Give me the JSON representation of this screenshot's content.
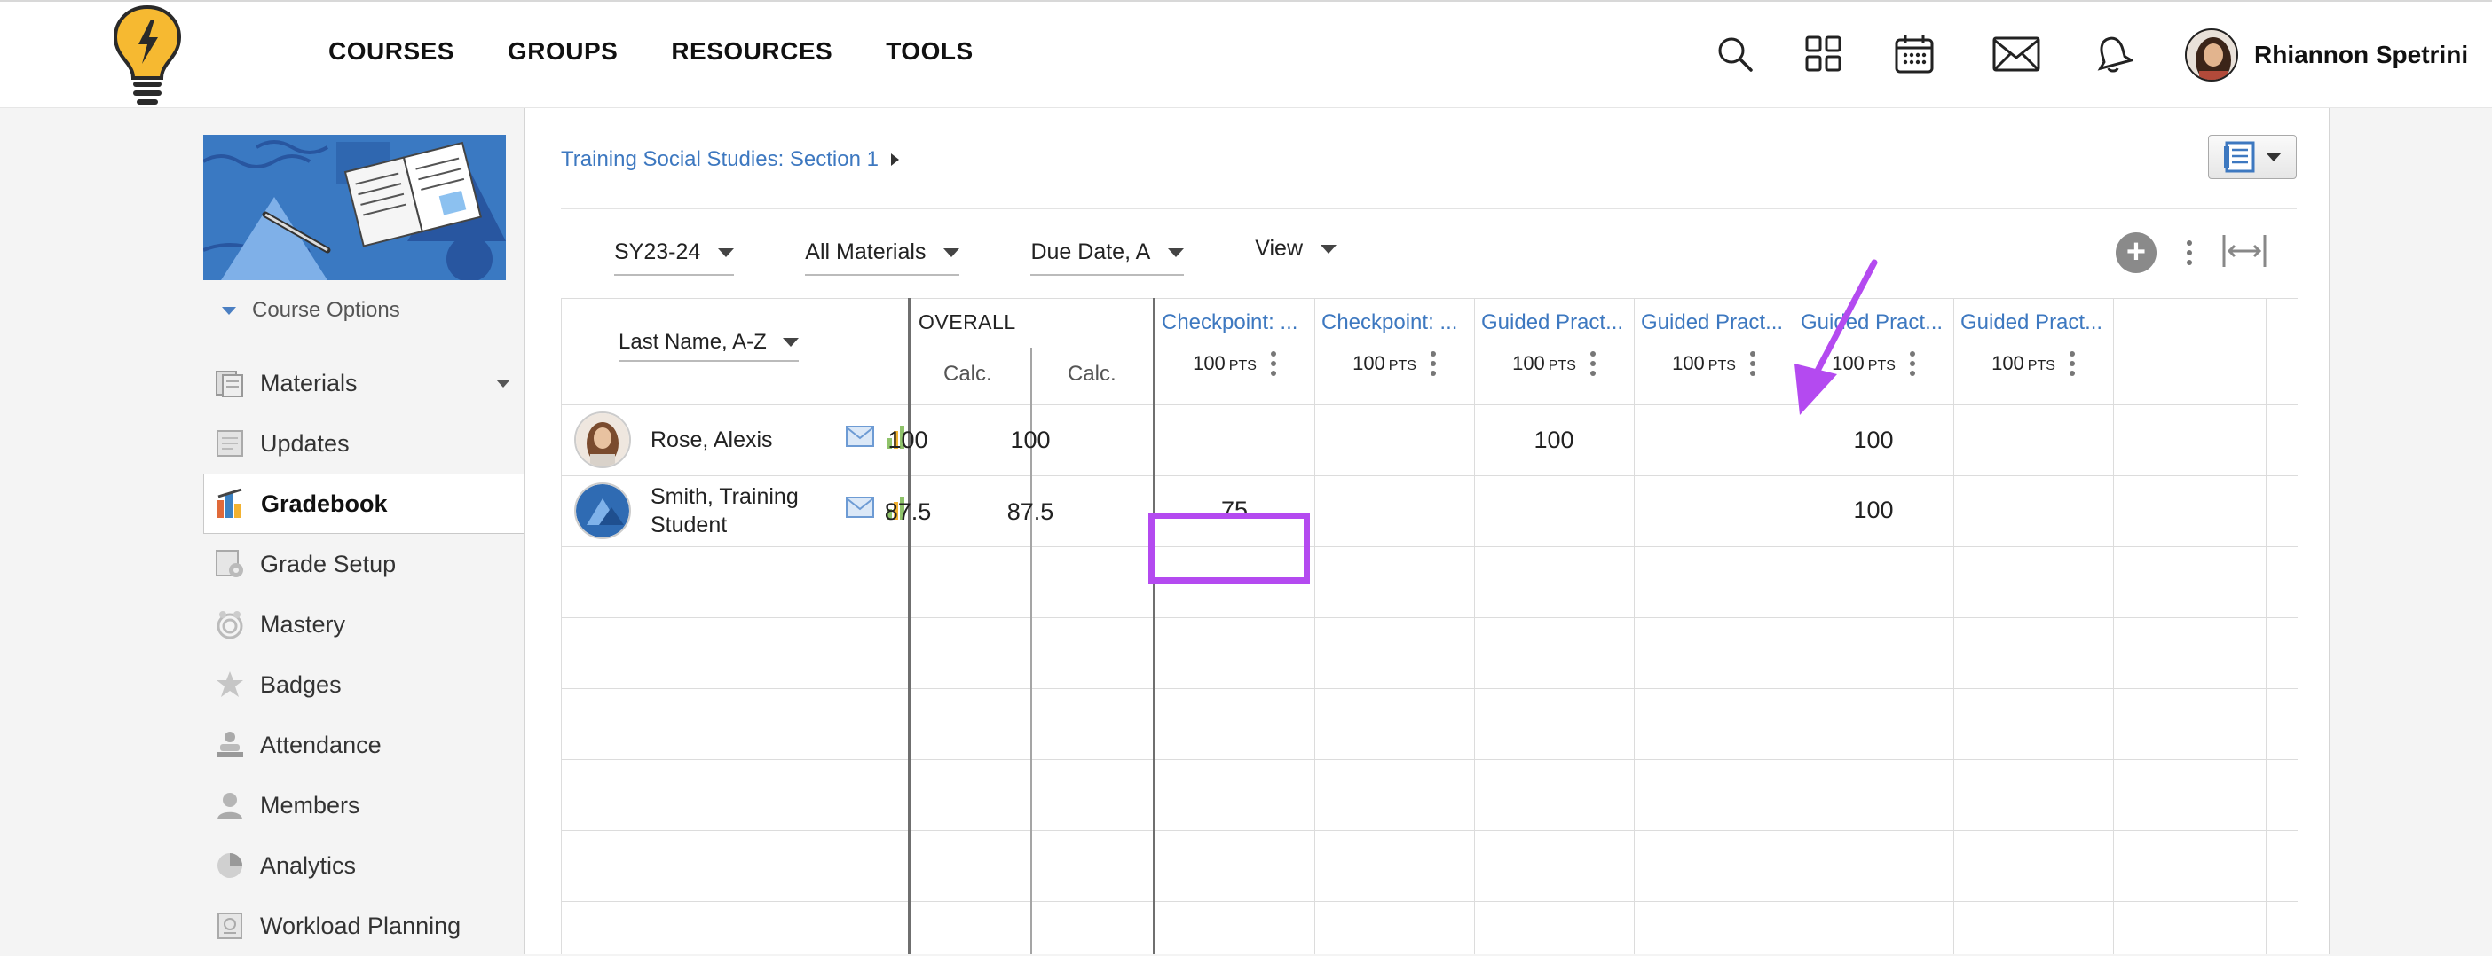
{
  "header": {
    "nav": [
      "COURSES",
      "GROUPS",
      "RESOURCES",
      "TOOLS"
    ],
    "icons": [
      "search-icon",
      "apps-grid-icon",
      "calendar-icon",
      "mail-icon",
      "notification-bell-icon"
    ],
    "user_name": "Rhiannon Spetrini"
  },
  "sidebar": {
    "course_options_label": "Course Options",
    "items": [
      {
        "label": "Materials",
        "icon": "materials-icon"
      },
      {
        "label": "Updates",
        "icon": "updates-icon"
      },
      {
        "label": "Gradebook",
        "icon": "gradebook-icon"
      },
      {
        "label": "Grade Setup",
        "icon": "grade-setup-icon"
      },
      {
        "label": "Mastery",
        "icon": "mastery-icon"
      },
      {
        "label": "Badges",
        "icon": "badges-icon"
      },
      {
        "label": "Attendance",
        "icon": "attendance-icon"
      },
      {
        "label": "Members",
        "icon": "members-icon"
      },
      {
        "label": "Analytics",
        "icon": "analytics-icon"
      },
      {
        "label": "Workload Planning",
        "icon": "workload-planning-icon"
      }
    ]
  },
  "main": {
    "breadcrumb": "Training Social Studies: Section 1",
    "filters": {
      "term": "SY23-24",
      "materials": "All Materials",
      "sort": "Due Date, A",
      "view": "View"
    },
    "grid": {
      "student_sort": "Last Name, A-Z",
      "overall_label": "OVERALL",
      "calc_labels": [
        "Calc.",
        "Calc."
      ],
      "columns": [
        {
          "title": "Checkpoint: ...",
          "points": "100",
          "pts_label": "PTS"
        },
        {
          "title": "Checkpoint: ...",
          "points": "100",
          "pts_label": "PTS"
        },
        {
          "title": "Guided Pract...",
          "points": "100",
          "pts_label": "PTS"
        },
        {
          "title": "Guided Pract...",
          "points": "100",
          "pts_label": "PTS"
        },
        {
          "title": "Guided Pract...",
          "points": "100",
          "pts_label": "PTS"
        },
        {
          "title": "Guided Pract...",
          "points": "100",
          "pts_label": "PTS"
        }
      ],
      "students": [
        {
          "name": "Rose, Alexis",
          "overall": [
            "100",
            "100"
          ],
          "grades": [
            "",
            "",
            "100",
            "",
            "100",
            ""
          ]
        },
        {
          "name": "Smith, Training Student",
          "overall": [
            "87.5",
            "87.5"
          ],
          "grades": [
            "75",
            "",
            "",
            "",
            "100",
            ""
          ]
        }
      ]
    }
  },
  "colors": {
    "link_blue": "#3d78c0",
    "highlight": "#b44af0"
  }
}
